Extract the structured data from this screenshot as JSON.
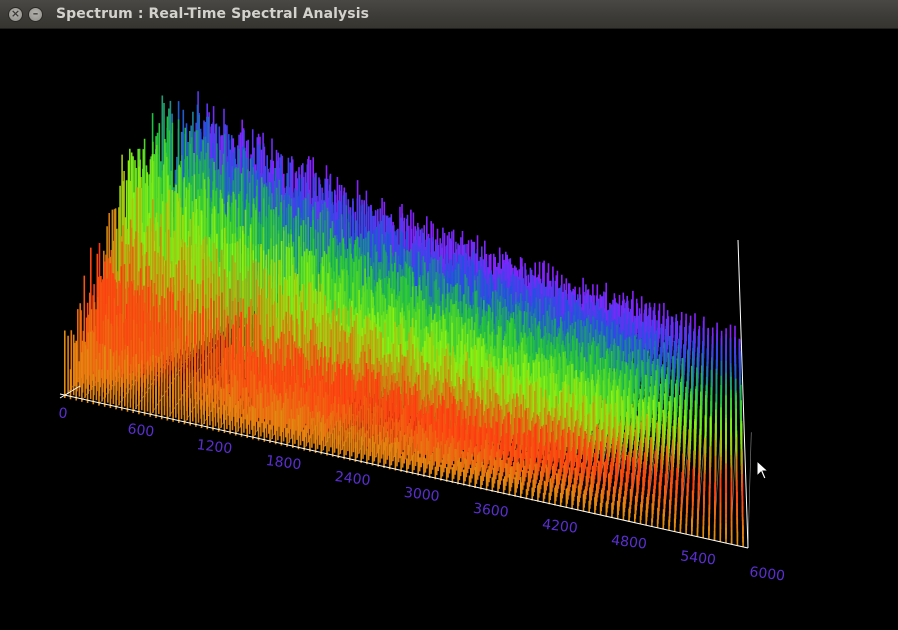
{
  "window": {
    "title": "Spectrum : Real-Time Spectral Analysis",
    "close_glyph": "×",
    "minimize_glyph": "–"
  },
  "spectrum_view": {
    "frequency_axis_ticks": [
      "0",
      "600",
      "1200",
      "1800",
      "2400",
      "3000",
      "3600",
      "4200",
      "4800",
      "5400",
      "6000"
    ],
    "colors": {
      "background": "#000000",
      "axis_lines": "#ffffff",
      "tick_labels": "#5a2fd0",
      "band_front": "#e08a10",
      "band_red": "#ff3a10",
      "band_yellowgreen": "#8cf010",
      "band_green": "#20c040",
      "band_blue": "#2050e0",
      "band_violet": "#8a20ff"
    }
  },
  "cursor_icon": "mouse-pointer-icon"
}
